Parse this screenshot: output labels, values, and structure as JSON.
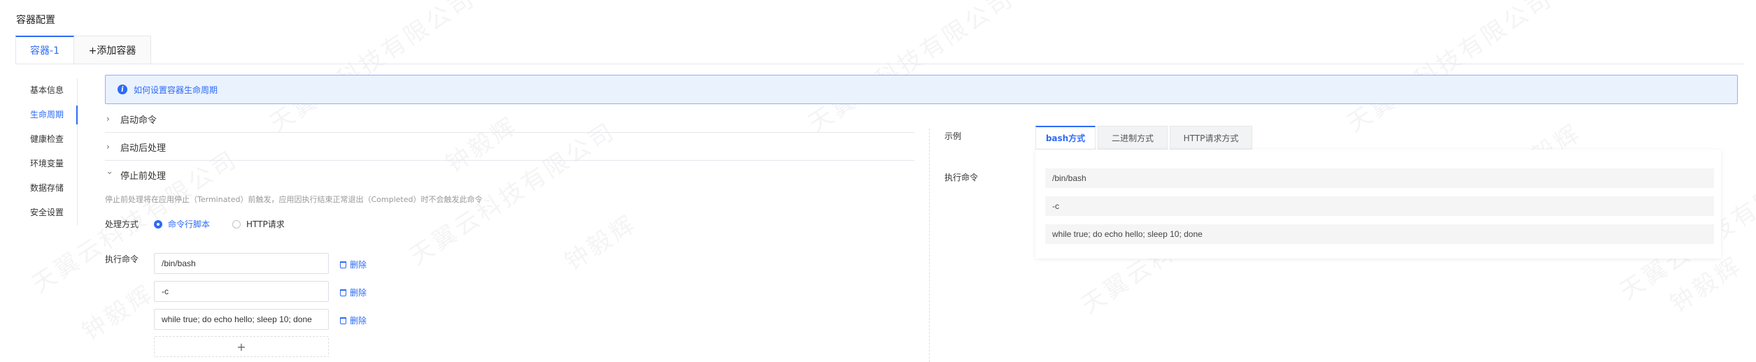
{
  "page": {
    "section_title": "容器配置"
  },
  "container_tabs": [
    {
      "label": "容器-1",
      "active": true
    },
    {
      "label": "+添加容器",
      "active": false
    }
  ],
  "left_nav": [
    {
      "label": "基本信息",
      "active": false
    },
    {
      "label": "生命周期",
      "active": true
    },
    {
      "label": "健康检查",
      "active": false
    },
    {
      "label": "环境变量",
      "active": false
    },
    {
      "label": "数据存储",
      "active": false
    },
    {
      "label": "安全设置",
      "active": false
    }
  ],
  "info_banner": {
    "icon": "info-icon",
    "text": "如何设置容器生命周期"
  },
  "collapses": [
    {
      "label": "启动命令",
      "expanded": false
    },
    {
      "label": "启动后处理",
      "expanded": false
    },
    {
      "label": "停止前处理",
      "expanded": true
    }
  ],
  "pre_stop": {
    "description": "停止前处理将在应用停止（Terminated）前触发，应用因执行结束正常退出（Completed）时不会触发此命令",
    "method_label": "处理方式",
    "options": [
      {
        "label": "命令行脚本",
        "selected": true
      },
      {
        "label": "HTTP请求",
        "selected": false
      }
    ],
    "exec_label": "执行命令",
    "commands": [
      "/bin/bash",
      "-c",
      "while true; do echo hello; sleep 10; done"
    ],
    "delete_label": "删除",
    "add_symbol": "+"
  },
  "example": {
    "label": "示例",
    "tabs": [
      {
        "label": "bash方式",
        "active": true
      },
      {
        "label": "二进制方式",
        "active": false
      },
      {
        "label": "HTTP请求方式",
        "active": false
      }
    ],
    "exec_label": "执行命令",
    "lines": [
      "/bin/bash",
      "-c",
      "while true; do echo hello; sleep 10; done"
    ]
  },
  "watermark": {
    "text": "天翼云科技有限公司",
    "name": "钟毅辉"
  },
  "colors": {
    "accent": "#2d6bf6",
    "banner_bg": "#eaf2fe",
    "border": "#e4e7ed"
  }
}
